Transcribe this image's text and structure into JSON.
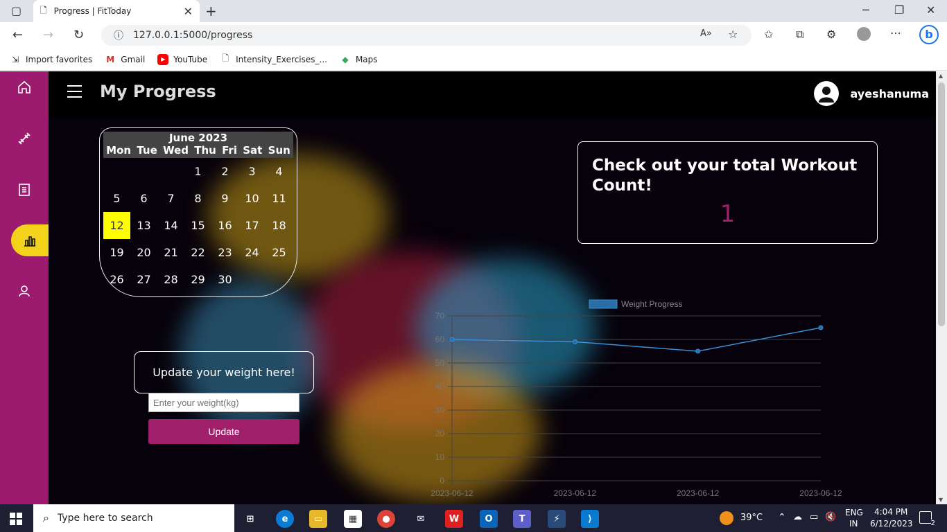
{
  "browser": {
    "tab_title": "Progress | FitToday",
    "url": "127.0.0.1:5000/progress",
    "favorites": [
      "Import favorites",
      "Gmail",
      "YouTube",
      "Intensity_Exercises_...",
      "Maps"
    ]
  },
  "header": {
    "title": "My Progress",
    "username": "ayeshanuma"
  },
  "calendar": {
    "month": "June 2023",
    "weekdays": [
      "Mon",
      "Tue",
      "Wed",
      "Thu",
      "Fri",
      "Sat",
      "Sun"
    ],
    "start_offset": 3,
    "days": 30,
    "today": 12
  },
  "workout": {
    "heading": "Check out your total Workout Count!",
    "count": "1"
  },
  "weight": {
    "heading": "Update your weight here!",
    "placeholder": "Enter your weight(kg)",
    "button": "Update"
  },
  "chart_data": {
    "type": "line",
    "categories": [
      "2023-06-12",
      "2023-06-12",
      "2023-06-12",
      "2023-06-12"
    ],
    "series": [
      {
        "name": "Weight Progress",
        "values": [
          60,
          59,
          55,
          65
        ],
        "color": "#3b8fd6"
      }
    ],
    "ylim": [
      0,
      70
    ],
    "yticks": [
      0,
      10,
      20,
      30,
      40,
      50,
      60,
      70
    ],
    "legend": "top"
  },
  "taskbar": {
    "search_placeholder": "Type here to search",
    "weather": "39°C",
    "lang": "ENG",
    "region": "IN",
    "time": "4:04 PM",
    "date": "6/12/2023",
    "notifications": "2"
  }
}
